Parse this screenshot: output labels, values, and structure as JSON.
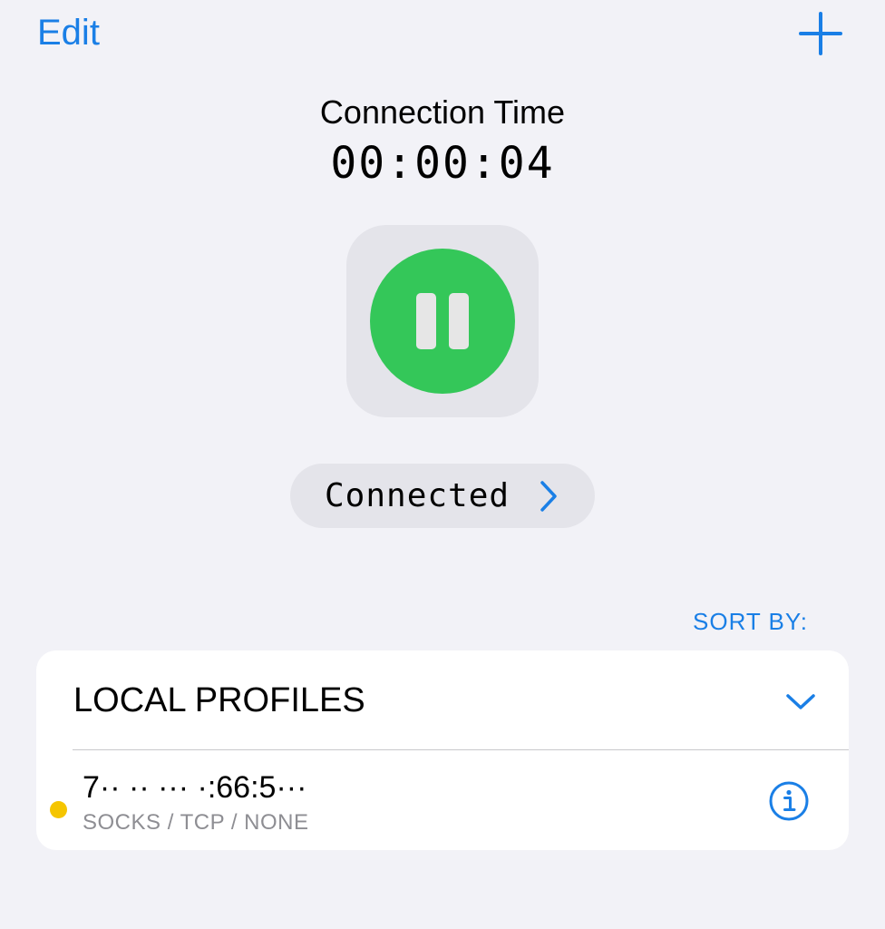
{
  "nav": {
    "edit_label": "Edit",
    "add_icon": "plus-icon"
  },
  "connection": {
    "title": "Connection Time",
    "timer": "00:00:04",
    "state": "connected",
    "toggle_icon": "pause-icon",
    "status_label": "Connected",
    "status_icon": "chevron-right-icon"
  },
  "sort": {
    "label": "SORT BY:"
  },
  "profiles_section": {
    "title": "LOCAL PROFILES",
    "expand_icon": "chevron-down-icon",
    "items": [
      {
        "name": "7·· ·· ··· ·:66:5···",
        "detail": "SOCKS / TCP / NONE",
        "status_color": "#f5c500",
        "info_icon": "info-icon"
      }
    ]
  },
  "colors": {
    "accent": "#1a7fe6",
    "connected_green": "#34c759",
    "background": "#f2f2f7",
    "card": "#ffffff",
    "secondary_text": "#8e8e93"
  }
}
